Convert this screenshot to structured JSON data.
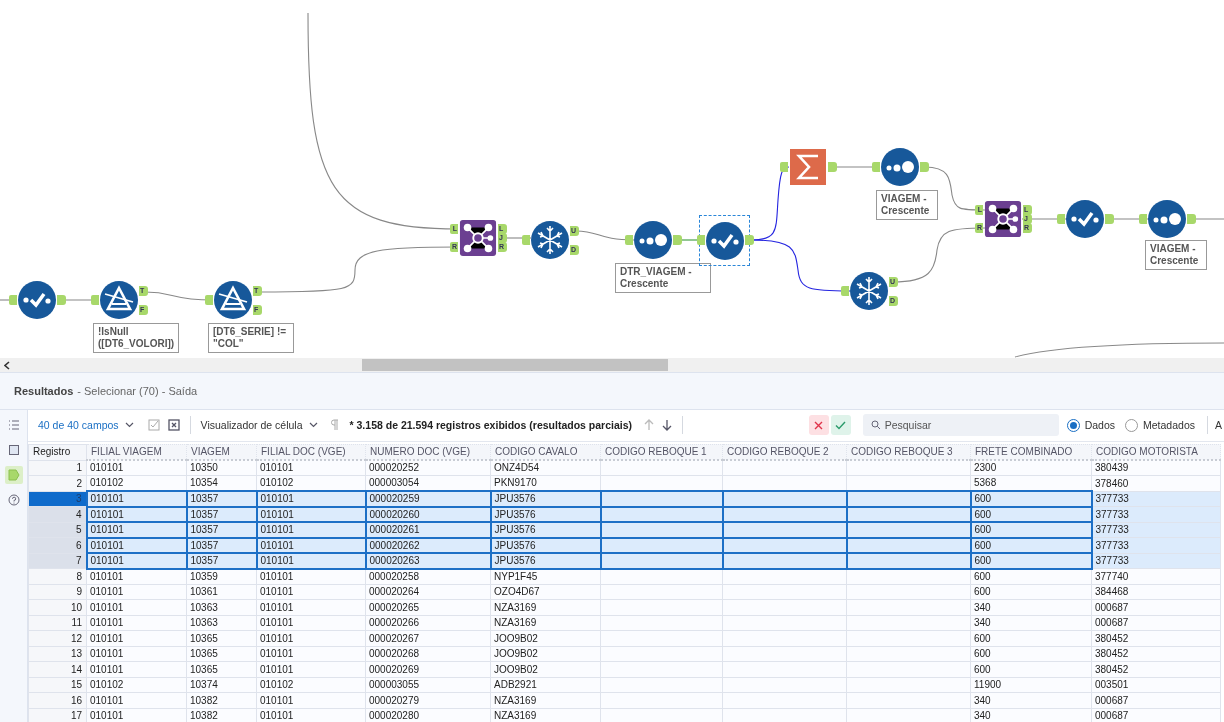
{
  "canvas": {
    "tools": [
      {
        "kind": "select",
        "selected": false
      },
      {
        "kind": "filter",
        "selected": false,
        "outputs": [
          "T",
          "F"
        ],
        "label": "!IsNull ([DT6_VOLORI])"
      },
      {
        "kind": "filter",
        "selected": false,
        "outputs": [
          "T",
          "F"
        ],
        "label": "[DT6_SERIE] != \"COL\""
      },
      {
        "kind": "join",
        "selected": false,
        "inputs": [
          "L",
          "R"
        ],
        "outputs": [
          "L",
          "J",
          "R"
        ]
      },
      {
        "kind": "unique",
        "selected": false,
        "outputs": [
          "U",
          "D"
        ]
      },
      {
        "kind": "sort",
        "selected": false,
        "label": "DTR_VIAGEM - Crescente"
      },
      {
        "kind": "select",
        "selected": true
      },
      {
        "kind": "summarize",
        "selected": false
      },
      {
        "kind": "sort",
        "selected": false,
        "label": "VIAGEM - Crescente"
      },
      {
        "kind": "unique",
        "selected": false,
        "outputs": [
          "U",
          "D"
        ]
      },
      {
        "kind": "join",
        "selected": false,
        "inputs": [
          "L",
          "R"
        ],
        "outputs": [
          "L",
          "J",
          "R"
        ]
      },
      {
        "kind": "select",
        "selected": false
      },
      {
        "kind": "sort",
        "selected": false,
        "label": "VIAGEM - Crescente"
      }
    ]
  },
  "results": {
    "title": "Resultados",
    "subtitle": "- Selecionar (70) - Saída"
  },
  "side_icons": [
    {
      "kind": "list",
      "selected": false
    },
    {
      "kind": "panel",
      "selected": false
    },
    {
      "kind": "tag",
      "selected": true
    },
    {
      "kind": "help",
      "selected": false
    }
  ],
  "toolbar": {
    "fields": "40 de 40 campos",
    "cell_viewer": "Visualizador de célula",
    "record_count": "* 3.158 de 21.594 registros exibidos (resultados parciais)",
    "nav_buttons": [
      {
        "kind": "up",
        "disabled": true
      },
      {
        "kind": "down",
        "disabled": false
      }
    ],
    "search": {
      "placeholder": "Pesquisar"
    },
    "view_options": [
      {
        "label": "Dados",
        "selected": true
      },
      {
        "label": "Metadados",
        "selected": false
      }
    ],
    "cut_text": "A"
  },
  "table": {
    "columns": [
      "Registro",
      "FILIAL VIAGEM",
      "VIAGEM",
      "FILIAL DOC (VGE)",
      "NUMERO DOC (VGE)",
      "CODIGO CAVALO",
      "CODIGO REBOQUE 1",
      "CODIGO REBOQUE 2",
      "CODIGO REBOQUE 3",
      "FRETE COMBINADO",
      "CODIGO MOTORISTA"
    ],
    "rows": [
      {
        "selected": false,
        "current": false,
        "cells": [
          "1",
          "010101",
          "10350",
          "010101",
          "000020252",
          "ONZ4D54",
          "",
          "",
          "",
          "2300",
          "380439"
        ]
      },
      {
        "selected": false,
        "current": false,
        "cells": [
          "2",
          "010102",
          "10354",
          "010102",
          "000003054",
          "PKN9170",
          "",
          "",
          "",
          "5368",
          "378460"
        ]
      },
      {
        "selected": true,
        "current": true,
        "cells": [
          "3",
          "010101",
          "10357",
          "010101",
          "000020259",
          "JPU3576",
          "",
          "",
          "",
          "600",
          "377733"
        ]
      },
      {
        "selected": true,
        "current": false,
        "cells": [
          "4",
          "010101",
          "10357",
          "010101",
          "000020260",
          "JPU3576",
          "",
          "",
          "",
          "600",
          "377733"
        ]
      },
      {
        "selected": true,
        "current": false,
        "cells": [
          "5",
          "010101",
          "10357",
          "010101",
          "000020261",
          "JPU3576",
          "",
          "",
          "",
          "600",
          "377733"
        ]
      },
      {
        "selected": true,
        "current": false,
        "cells": [
          "6",
          "010101",
          "10357",
          "010101",
          "000020262",
          "JPU3576",
          "",
          "",
          "",
          "600",
          "377733"
        ]
      },
      {
        "selected": true,
        "current": false,
        "cells": [
          "7",
          "010101",
          "10357",
          "010101",
          "000020263",
          "JPU3576",
          "",
          "",
          "",
          "600",
          "377733"
        ]
      },
      {
        "selected": false,
        "current": false,
        "cells": [
          "8",
          "010101",
          "10359",
          "010101",
          "000020258",
          "NYP1F45",
          "",
          "",
          "",
          "600",
          "377740"
        ]
      },
      {
        "selected": false,
        "current": false,
        "cells": [
          "9",
          "010101",
          "10361",
          "010101",
          "000020264",
          "OZO4D67",
          "",
          "",
          "",
          "600",
          "384468"
        ]
      },
      {
        "selected": false,
        "current": false,
        "cells": [
          "10",
          "010101",
          "10363",
          "010101",
          "000020265",
          "NZA3169",
          "",
          "",
          "",
          "340",
          "000687"
        ]
      },
      {
        "selected": false,
        "current": false,
        "cells": [
          "11",
          "010101",
          "10363",
          "010101",
          "000020266",
          "NZA3169",
          "",
          "",
          "",
          "340",
          "000687"
        ]
      },
      {
        "selected": false,
        "current": false,
        "cells": [
          "12",
          "010101",
          "10365",
          "010101",
          "000020267",
          "JOO9B02",
          "",
          "",
          "",
          "600",
          "380452"
        ]
      },
      {
        "selected": false,
        "current": false,
        "cells": [
          "13",
          "010101",
          "10365",
          "010101",
          "000020268",
          "JOO9B02",
          "",
          "",
          "",
          "600",
          "380452"
        ]
      },
      {
        "selected": false,
        "current": false,
        "cells": [
          "14",
          "010101",
          "10365",
          "010101",
          "000020269",
          "JOO9B02",
          "",
          "",
          "",
          "600",
          "380452"
        ]
      },
      {
        "selected": false,
        "current": false,
        "cells": [
          "15",
          "010102",
          "10374",
          "010102",
          "000003055",
          "ADB2921",
          "",
          "",
          "",
          "11900",
          "003501"
        ]
      },
      {
        "selected": false,
        "current": false,
        "cells": [
          "16",
          "010101",
          "10382",
          "010101",
          "000020279",
          "NZA3169",
          "",
          "",
          "",
          "340",
          "000687"
        ]
      },
      {
        "selected": false,
        "current": false,
        "cells": [
          "17",
          "010101",
          "10382",
          "010101",
          "000020280",
          "NZA3169",
          "",
          "",
          "",
          "340",
          "000687"
        ]
      }
    ]
  }
}
